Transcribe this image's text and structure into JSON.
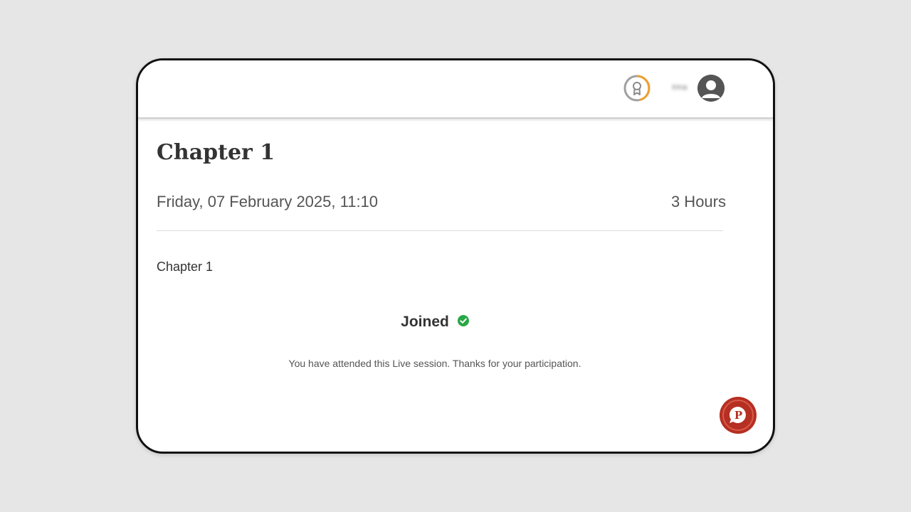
{
  "header": {
    "badge_icon": "ribbon-award-icon",
    "badge_accent": "#f0a030",
    "username": "Irina",
    "avatar_icon": "user-avatar-icon"
  },
  "session": {
    "title": "Chapter 1",
    "datetime": "Friday, 07 February 2025, 11:10",
    "duration": "3 Hours",
    "description": "Chapter 1",
    "status_label": "Joined",
    "status_icon": "check-circle-icon",
    "status_color": "#28a745",
    "attended_message": "You have attended this Live session. Thanks for your participation."
  },
  "chat_widget": {
    "icon": "chat-p-icon",
    "color": "#b52f22"
  }
}
